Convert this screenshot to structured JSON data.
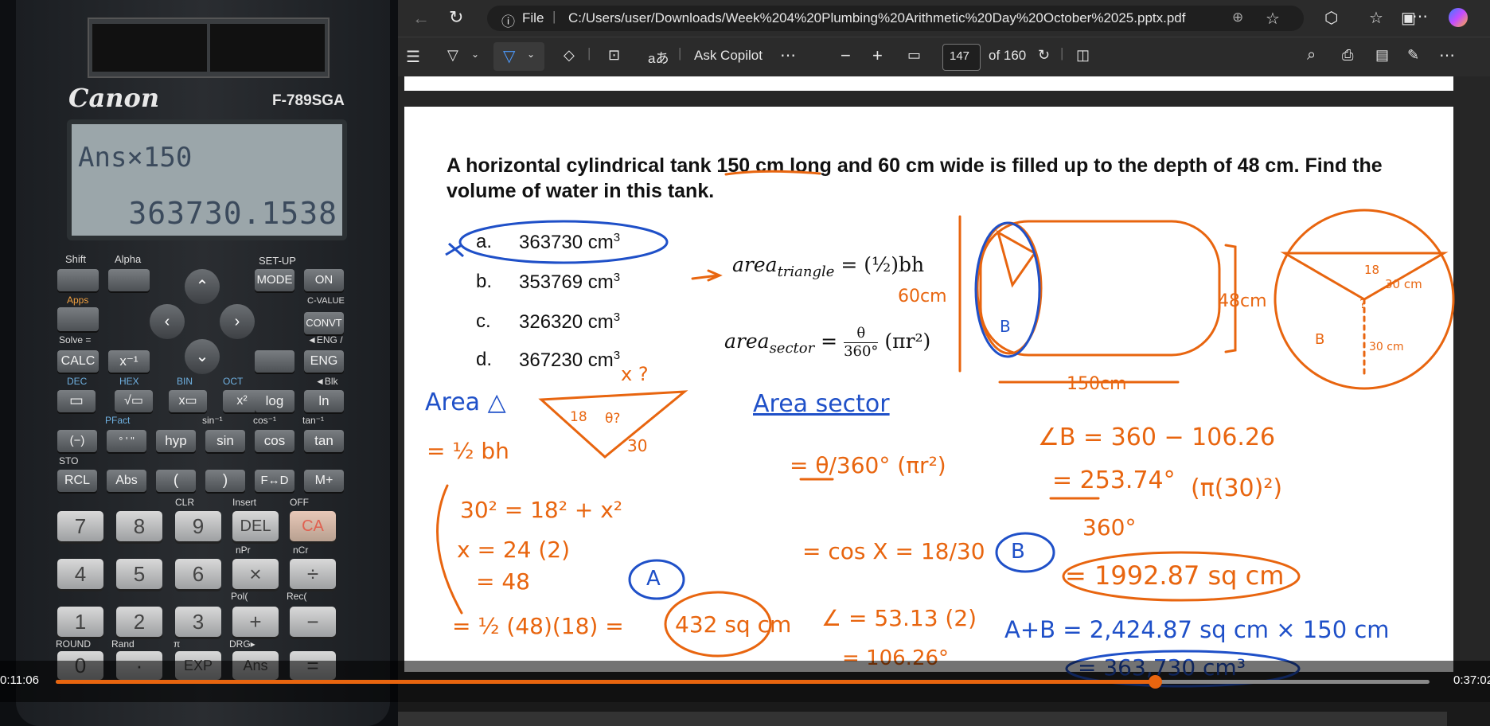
{
  "calculator": {
    "brand": "Canon",
    "model": "F-789SGA",
    "display_input": "Ans×150",
    "display_result": "363730.1538",
    "labels": {
      "shift": "Shift",
      "alpha": "Alpha",
      "setup": "SET-UP",
      "mode": "MODE",
      "on": "ON",
      "apps": "Apps",
      "cvalue": "C-VALUE",
      "convt": "CONVT",
      "solve": "Solve =",
      "calc": "CALC",
      "xinv": "x⁻¹",
      "eng": "ENG",
      "eng_sub": "◄ENG /",
      "dec": "DEC",
      "hex": "HEX",
      "bin": "BIN",
      "oct": "OCT",
      "blk": "◄Blk",
      "frac": "▭",
      "sqrt": "√▭",
      "pow": "x▭",
      "sq": "x²",
      "log": "log",
      "ln": "ln",
      "pfact": "PFact",
      "neg": "(−)",
      "dms": "° ' \"",
      "hyp": "hyp",
      "sin": "sin",
      "cos": "cos",
      "tan": "tan",
      "sin_inv": "sin⁻¹",
      "cos_inv": "cos⁻¹",
      "tan_inv": "tan⁻¹",
      "sto": "STO",
      "rcl": "RCL",
      "abs": "Abs",
      "lparen": "(",
      "rparen": ")",
      "fd": "F↔D",
      "mplus": "M+",
      "clr": "CLR",
      "insert": "Insert",
      "off": "OFF",
      "del": "DEL",
      "ac": "CA",
      "npr": "nPr",
      "ncr": "nCr",
      "pol": "Pol(",
      "rec": "Rec(",
      "times": "×",
      "div": "÷",
      "plus": "+",
      "minus": "−",
      "round": "ROUND",
      "rand": "Rand",
      "randint": "Rand",
      "pi": "π",
      "drg": "DRG▸",
      "zero": "0",
      "dot": "·",
      "exp": "EXP",
      "ans": "Ans",
      "eq": "="
    },
    "digits": [
      "7",
      "8",
      "9",
      "4",
      "5",
      "6",
      "1",
      "2",
      "3"
    ]
  },
  "browser": {
    "info_label": "File",
    "url": "C:/Users/user/Downloads/Week%204%20Plumbing%20Arithmetic%20Day%20October%2025.pptx.pdf",
    "ask_copilot": "Ask Copilot",
    "text_tool": "aあ",
    "page_current": "147",
    "page_total": "of 160"
  },
  "slide": {
    "question": "A horizontal cylindrical tank 150 cm long and 60 cm wide is filled up to the depth of 48 cm. Find the volume of water in this tank.",
    "options": [
      {
        "letter": "a.",
        "text": "363730 cm",
        "sup": "3"
      },
      {
        "letter": "b.",
        "text": "353769 cm",
        "sup": "3"
      },
      {
        "letter": "c.",
        "text": "326320 cm",
        "sup": "3"
      },
      {
        "letter": "d.",
        "text": "367230 cm",
        "sup": "3"
      }
    ],
    "formula_triangle": "area",
    "formula_triangle_sub": "triangle",
    "formula_triangle_rhs": "= (½)bh",
    "formula_sector": "area",
    "formula_sector_sub": "sector",
    "formula_sector_num": "θ",
    "formula_sector_den": "360°",
    "formula_sector_rhs": "(πr²)"
  },
  "handwriting": {
    "arrow": "→",
    "w60": "60cm",
    "h48": "48cm",
    "l150": "150cm",
    "area_tri": "Area △",
    "half_bh": "= ½ bh",
    "x_q": "x ?",
    "n18": "18",
    "n30": "30",
    "theta_q": "θ?",
    "pyth": "30² = 18² + x²",
    "x24": "x = 24 (2)",
    "eq48": "= 48",
    "tri_calc": "= ½ (48)(18) =",
    "tri_ans": "432 sq cm",
    "label_a": "A",
    "label_b": "B",
    "area_sector": "Area sector",
    "sec_formula": "= θ/360° (πr²)",
    "cos_x": "= cos X = 18/30",
    "angle": "∠ = 53.13 (2)",
    "angle2": "= 106.26°",
    "angle_b": "∠B = 360 − 106.26",
    "angle_b2": "= 253.74°",
    "den360": "360°",
    "pi30": "(π(30)²)",
    "sector_ans": "= 1992.87 sq cm",
    "sum": "A+B = 2,424.87 sq cm × 150 cm",
    "final": "= 363,730 cm³",
    "c18": "18",
    "c30": "30 cm",
    "c30b": "30 cm",
    "cq": "?"
  },
  "video": {
    "time_left": "0:11:06",
    "time_right": "0:37:02",
    "progress": 0.8,
    "accent": "#e8650f"
  }
}
